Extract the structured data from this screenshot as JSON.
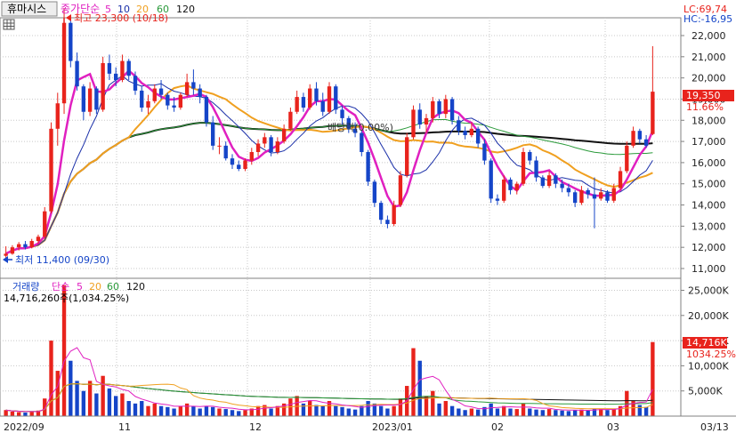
{
  "header": {
    "stock_name": "휴마시스",
    "ma_label": "종가단순",
    "ma_periods": [
      "5",
      "10",
      "20",
      "60",
      "120"
    ],
    "lc": "LC:69,74",
    "hc": "HC:-16,95"
  },
  "colors": {
    "up": "#e8231c",
    "down": "#1545c8",
    "ma5": "#e020c0",
    "ma10": "#1a2fa8",
    "ma20": "#f0a020",
    "ma60": "#2a9a3a",
    "ma120": "#111111",
    "grid": "#c8c8c8",
    "axis": "#808080"
  },
  "price_panel": {
    "high_label": "최고 23,300 (10/18)",
    "low_label": "최저 11,400 (09/30)",
    "dividend_label": "배당락(0.00%)",
    "current_price": "19,350",
    "current_change": "11.66%"
  },
  "volume_panel": {
    "title": "거래량",
    "ma_label": "단순",
    "ma_periods": [
      "5",
      "20",
      "60",
      "120"
    ],
    "current_volume_label": "14,716,260주(1,034.25%)",
    "current_volume": "14,716K",
    "current_change": "1034.25%"
  },
  "chart_data": [
    {
      "type": "candlestick",
      "title": "",
      "ylim": [
        10500,
        23700
      ],
      "y_ticks": [
        "11,000",
        "12,000",
        "13,000",
        "14,000",
        "15,000",
        "16,000",
        "17,000",
        "18,000",
        "19,000",
        "20,000",
        "21,000",
        "22,000"
      ],
      "x_ticks": [
        "2022/09",
        "11",
        "12",
        "2023/01",
        "02",
        "03",
        "03/13"
      ],
      "moving_averages": [
        "5",
        "10",
        "20",
        "60",
        "120"
      ],
      "ohlc": [
        [
          11600,
          12050,
          11400,
          11700
        ],
        [
          11700,
          12100,
          11650,
          12000
        ],
        [
          12000,
          12250,
          11850,
          12150
        ],
        [
          12150,
          12300,
          11900,
          12000
        ],
        [
          12000,
          12400,
          11950,
          12300
        ],
        [
          12300,
          12600,
          12150,
          12500
        ],
        [
          12500,
          13900,
          12400,
          13700
        ],
        [
          13700,
          17900,
          13600,
          17600
        ],
        [
          17600,
          19300,
          16800,
          18800
        ],
        [
          18800,
          23300,
          18300,
          22600
        ],
        [
          22600,
          22900,
          20500,
          20800
        ],
        [
          20800,
          21200,
          19400,
          19600
        ],
        [
          19600,
          19700,
          18000,
          18400
        ],
        [
          18400,
          19800,
          18200,
          19500
        ],
        [
          19500,
          19600,
          18300,
          18500
        ],
        [
          18500,
          21000,
          18400,
          20700
        ],
        [
          20700,
          21100,
          19900,
          20200
        ],
        [
          20200,
          20500,
          19600,
          19900
        ],
        [
          19900,
          21100,
          19800,
          20800
        ],
        [
          20800,
          20900,
          19900,
          20100
        ],
        [
          20100,
          20300,
          19200,
          19400
        ],
        [
          19400,
          19600,
          18400,
          18600
        ],
        [
          18600,
          19200,
          18300,
          18900
        ],
        [
          18900,
          19700,
          18800,
          19500
        ],
        [
          19500,
          19900,
          19000,
          19200
        ],
        [
          19200,
          19300,
          18500,
          18700
        ],
        [
          18700,
          19100,
          18400,
          18600
        ],
        [
          18600,
          19300,
          18500,
          19200
        ],
        [
          19200,
          20200,
          19100,
          19800
        ],
        [
          19800,
          20400,
          19200,
          19500
        ],
        [
          19500,
          19700,
          18800,
          19100
        ],
        [
          19100,
          19200,
          17700,
          17900
        ],
        [
          17900,
          18200,
          16600,
          16800
        ],
        [
          16800,
          17200,
          16400,
          16800
        ],
        [
          16800,
          17000,
          16100,
          16200
        ],
        [
          16200,
          16400,
          15700,
          15900
        ],
        [
          15900,
          16100,
          15600,
          15700
        ],
        [
          15700,
          16200,
          15600,
          16100
        ],
        [
          16100,
          16700,
          15900,
          16500
        ],
        [
          16500,
          17100,
          16300,
          16900
        ],
        [
          16900,
          17400,
          16700,
          17200
        ],
        [
          17200,
          17300,
          16300,
          16500
        ],
        [
          16500,
          17200,
          16400,
          17000
        ],
        [
          17000,
          17800,
          16900,
          17600
        ],
        [
          17600,
          18600,
          17500,
          18400
        ],
        [
          18400,
          19400,
          18300,
          19100
        ],
        [
          19100,
          19300,
          18400,
          18600
        ],
        [
          18600,
          19700,
          18500,
          19500
        ],
        [
          19500,
          19800,
          18700,
          18900
        ],
        [
          18900,
          19300,
          18200,
          18400
        ],
        [
          18400,
          19800,
          18300,
          19600
        ],
        [
          19600,
          19700,
          18300,
          18500
        ],
        [
          18500,
          18700,
          17800,
          18100
        ],
        [
          18100,
          18200,
          17400,
          17600
        ],
        [
          17600,
          17900,
          17200,
          17400
        ],
        [
          17400,
          17500,
          16300,
          16500
        ],
        [
          16500,
          16600,
          14900,
          15100
        ],
        [
          15100,
          15200,
          13900,
          14100
        ],
        [
          14100,
          14200,
          13100,
          13300
        ],
        [
          13300,
          13500,
          12900,
          13100
        ],
        [
          13100,
          14200,
          13000,
          14000
        ],
        [
          14000,
          15600,
          13900,
          15400
        ],
        [
          15400,
          17400,
          15300,
          17200
        ],
        [
          17200,
          18700,
          17100,
          18500
        ],
        [
          18500,
          18800,
          17600,
          17800
        ],
        [
          17800,
          18300,
          17400,
          18100
        ],
        [
          18100,
          19100,
          17900,
          18900
        ],
        [
          18900,
          19000,
          18100,
          18300
        ],
        [
          18300,
          19200,
          18100,
          19000
        ],
        [
          19000,
          19100,
          17800,
          18000
        ],
        [
          18000,
          18200,
          17300,
          17500
        ],
        [
          17500,
          17700,
          17100,
          17300
        ],
        [
          17300,
          17900,
          17200,
          17600
        ],
        [
          17600,
          17700,
          16700,
          16900
        ],
        [
          16900,
          17100,
          15900,
          16100
        ],
        [
          16100,
          16200,
          14100,
          14300
        ],
        [
          14300,
          14500,
          14000,
          14200
        ],
        [
          14200,
          15400,
          14100,
          15200
        ],
        [
          15200,
          15300,
          14500,
          14700
        ],
        [
          14700,
          15100,
          14500,
          15000
        ],
        [
          15000,
          16700,
          14900,
          16500
        ],
        [
          16500,
          16600,
          15900,
          16100
        ],
        [
          16100,
          16300,
          15100,
          15300
        ],
        [
          15300,
          15400,
          14800,
          14900
        ],
        [
          14900,
          15600,
          14800,
          15400
        ],
        [
          15400,
          15500,
          14800,
          15000
        ],
        [
          15000,
          15200,
          14600,
          14800
        ],
        [
          14800,
          15000,
          14400,
          14600
        ],
        [
          14600,
          14700,
          13900,
          14100
        ],
        [
          14100,
          14900,
          14000,
          14700
        ],
        [
          14700,
          14800,
          14300,
          14500
        ],
        [
          14500,
          15300,
          12900,
          14300
        ],
        [
          14300,
          14800,
          14200,
          14600
        ],
        [
          14600,
          14700,
          14100,
          14200
        ],
        [
          14200,
          15000,
          14100,
          14800
        ],
        [
          14800,
          15800,
          14700,
          15600
        ],
        [
          15600,
          17000,
          15500,
          16800
        ],
        [
          16800,
          17700,
          16700,
          17500
        ],
        [
          17500,
          17600,
          16900,
          17100
        ],
        [
          17100,
          17300,
          16700,
          16800
        ],
        [
          17350,
          21500,
          17300,
          19350
        ]
      ]
    },
    {
      "type": "bar",
      "title": "거래량",
      "ylim": [
        0,
        27000
      ],
      "y_ticks": [
        "5,000K",
        "10,000K",
        "15,000K",
        "20,000K",
        "25,000K"
      ],
      "moving_averages": [
        "5",
        "20",
        "60",
        "120"
      ],
      "values": [
        1200,
        900,
        800,
        700,
        900,
        1100,
        3500,
        15000,
        9000,
        26000,
        11000,
        7000,
        5000,
        7000,
        4500,
        8000,
        5500,
        4000,
        4500,
        3000,
        2500,
        3000,
        2000,
        2500,
        2000,
        1800,
        1500,
        2000,
        2500,
        2000,
        1500,
        2000,
        1800,
        1500,
        1400,
        1200,
        1000,
        1200,
        1500,
        2000,
        2200,
        1500,
        2000,
        2500,
        3500,
        4000,
        2500,
        3000,
        2200,
        2000,
        3000,
        2000,
        1800,
        1500,
        1300,
        2000,
        3000,
        2500,
        2000,
        1500,
        2000,
        3500,
        6000,
        13500,
        11000,
        4000,
        5000,
        2500,
        3000,
        2000,
        1500,
        1200,
        1500,
        1300,
        1800,
        2500,
        1500,
        2000,
        1500,
        1400,
        2500,
        1500,
        1300,
        1200,
        1400,
        1200,
        1100,
        1000,
        1200,
        1300,
        1100,
        1500,
        1400,
        1200,
        1400,
        2000,
        5000,
        3000,
        2200,
        1800,
        14716
      ]
    }
  ]
}
